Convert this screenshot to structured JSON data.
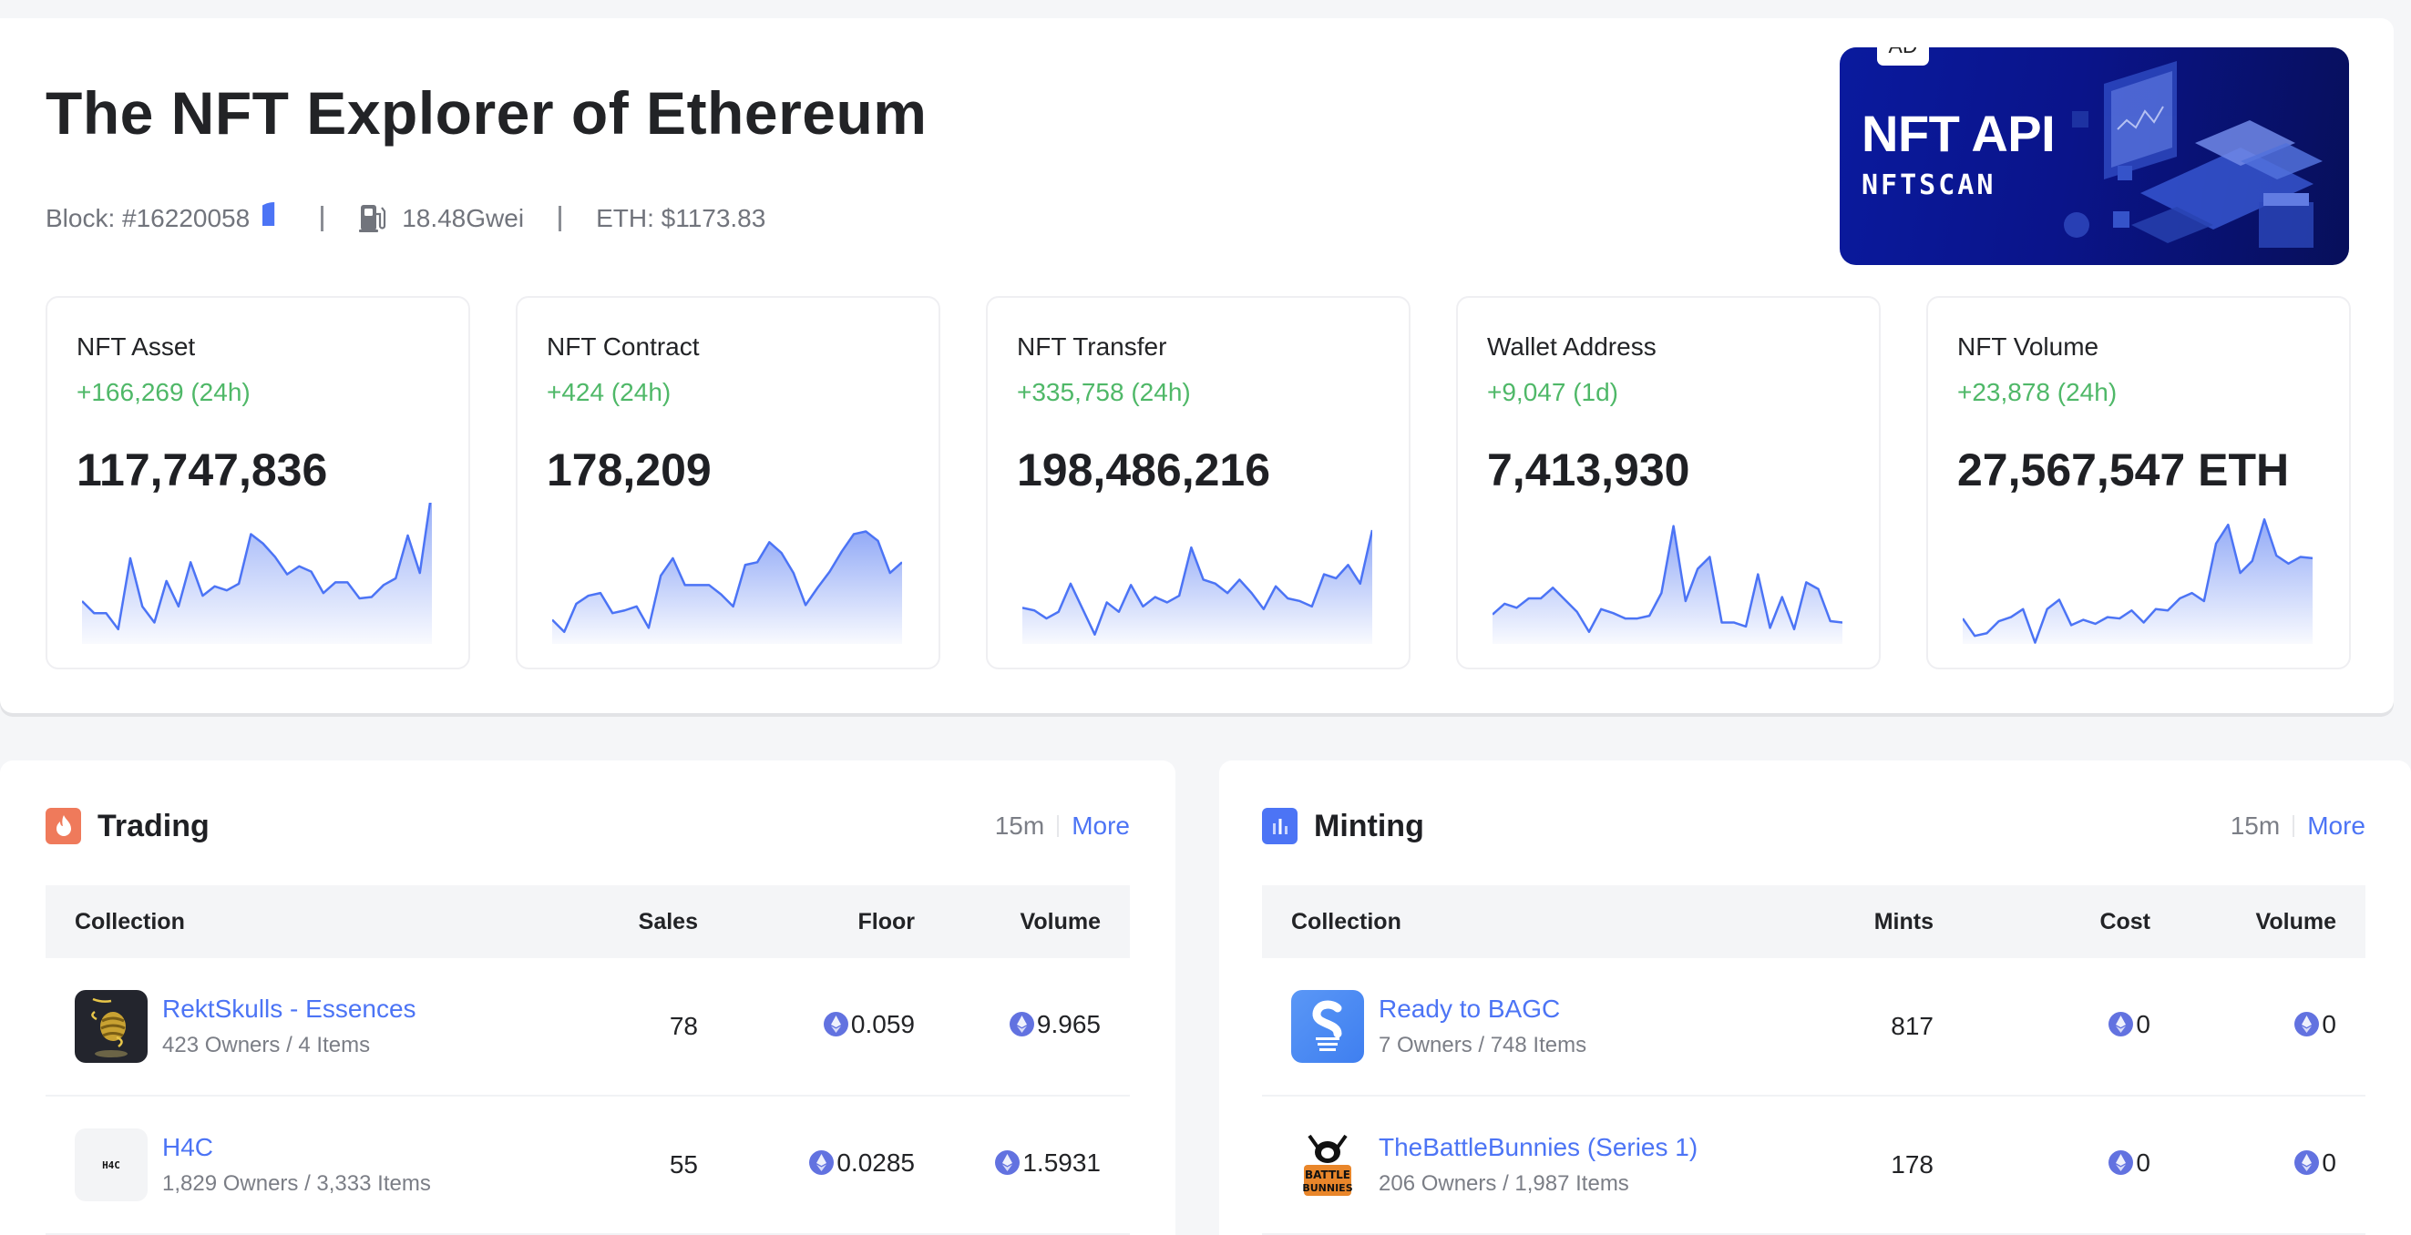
{
  "header": {
    "title": "The NFT Explorer of Ethereum",
    "block_label": "Block: #16220058",
    "gas_label": "18.48Gwei",
    "eth_price_label": "ETH: $1173.83"
  },
  "ad": {
    "badge": "AD",
    "title": "NFT API",
    "brand": "NFTSCAN"
  },
  "stats": [
    {
      "label": "NFT Asset",
      "delta": "+166,269 (24h)",
      "value": "117,747,836",
      "spark": [
        32,
        23,
        23,
        11,
        64,
        28,
        16,
        47,
        28,
        61,
        36,
        43,
        40,
        45,
        82,
        75,
        65,
        52,
        58,
        54,
        38,
        46,
        46,
        34,
        35,
        44,
        49,
        81,
        53,
        115
      ]
    },
    {
      "label": "NFT Contract",
      "delta": "+424 (24h)",
      "value": "178,209",
      "spark": [
        18,
        9,
        30,
        36,
        38,
        23,
        25,
        28,
        12,
        51,
        64,
        44,
        44,
        44,
        37,
        28,
        59,
        61,
        76,
        68,
        53,
        29,
        42,
        54,
        69,
        82,
        84,
        77,
        53,
        61
      ]
    },
    {
      "label": "NFT Transfer",
      "delta": "+335,758 (24h)",
      "value": "198,486,216",
      "spark": [
        27,
        25,
        19,
        24,
        45,
        26,
        7,
        31,
        24,
        44,
        28,
        35,
        31,
        36,
        72,
        48,
        45,
        38,
        48,
        38,
        26,
        43,
        34,
        32,
        28,
        52,
        49,
        59,
        45,
        85
      ]
    },
    {
      "label": "Wallet Address",
      "delta": "+9,047 (1d)",
      "value": "7,413,930",
      "spark": [
        22,
        30,
        27,
        34,
        34,
        42,
        33,
        24,
        9,
        26,
        23,
        19,
        19,
        21,
        38,
        88,
        32,
        56,
        65,
        16,
        16,
        13,
        52,
        12,
        35,
        11,
        46,
        41,
        17,
        16
      ]
    },
    {
      "label": "NFT Volume",
      "delta": "+23,878 (24h)",
      "value": "27,567,547 ETH",
      "spark": [
        19,
        6,
        8,
        17,
        20,
        26,
        1,
        26,
        33,
        14,
        18,
        15,
        20,
        19,
        25,
        16,
        26,
        25,
        34,
        38,
        32,
        75,
        89,
        53,
        62,
        93,
        66,
        60,
        65,
        64
      ]
    }
  ],
  "trading": {
    "title": "Trading",
    "range": "15m",
    "more": "More",
    "columns": [
      "Collection",
      "Sales",
      "Floor",
      "Volume"
    ],
    "rows": [
      {
        "name": "RektSkulls - Essences",
        "sub": "423 Owners / 4 Items",
        "sales": "78",
        "floor": "0.059",
        "volume": "9.965",
        "thumb": "rekt"
      },
      {
        "name": "H4C",
        "sub": "1,829 Owners / 3,333 Items",
        "sales": "55",
        "floor": "0.0285",
        "volume": "1.5931",
        "thumb": "h4c",
        "thumb_text": "H4C"
      }
    ]
  },
  "minting": {
    "title": "Minting",
    "range": "15m",
    "more": "More",
    "columns": [
      "Collection",
      "Mints",
      "Cost",
      "Volume"
    ],
    "rows": [
      {
        "name": "Ready to BAGC",
        "sub": "7 Owners / 748 Items",
        "mints": "817",
        "cost": "0",
        "volume": "0",
        "thumb": "bagc"
      },
      {
        "name": "TheBattleBunnies (Series 1)",
        "sub": "206 Owners / 1,987 Items",
        "mints": "178",
        "cost": "0",
        "volume": "0",
        "thumb": "bunnies"
      }
    ]
  },
  "colors": {
    "accent": "#4c74f5",
    "positive": "#4fb868",
    "trading_icon": "#ef7a5b",
    "minting_icon": "#4c74f5",
    "eth_icon": "#6272e0"
  }
}
